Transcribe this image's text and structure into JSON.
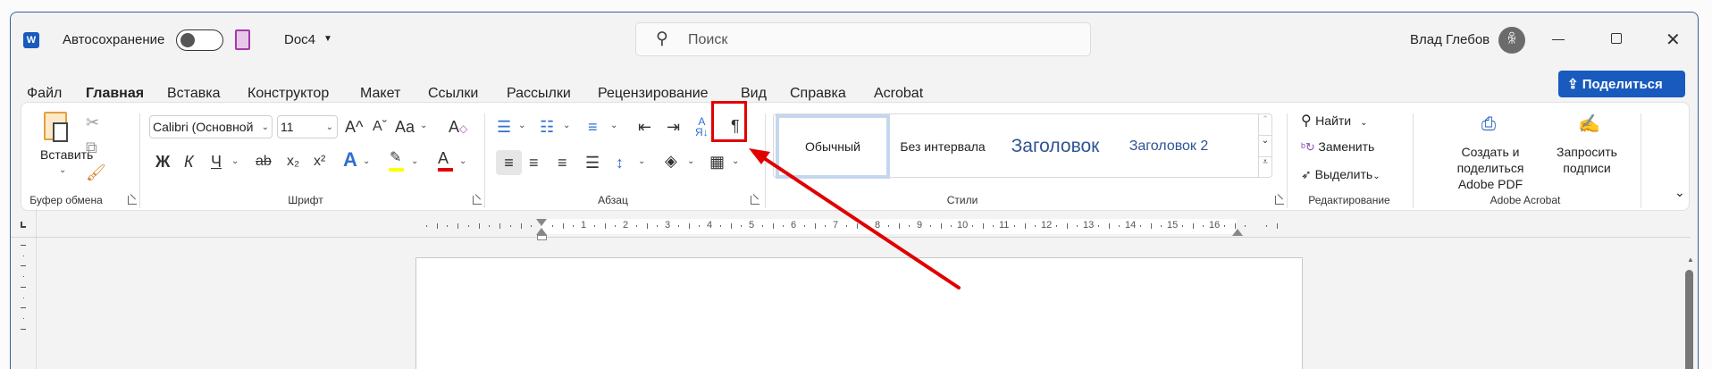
{
  "titlebar": {
    "app_icon": "word-icon",
    "autosave_label": "Автосохранение",
    "autosave_on": false,
    "doc_name": "Doc4",
    "search_placeholder": "Поиск",
    "user_name": "Влад Глебов"
  },
  "tabs": [
    "Файл",
    "Главная",
    "Вставка",
    "Конструктор",
    "Макет",
    "Ссылки",
    "Рассылки",
    "Рецензирование",
    "Вид",
    "Справка",
    "Acrobat"
  ],
  "active_tab": "Главная",
  "share_label": "Поделиться",
  "clipboard": {
    "paste": "Вставить",
    "group": "Буфер обмена"
  },
  "font": {
    "name": "Calibri (Основной",
    "size": "11",
    "grow": "A^",
    "shrink": "Aˇ",
    "case": "Aa",
    "bold": "Ж",
    "italic": "К",
    "underline": "Ч",
    "strike": "ab",
    "sub": "x₂",
    "sup": "x²",
    "group": "Шрифт"
  },
  "paragraph": {
    "pilcrow": "¶",
    "group": "Абзац"
  },
  "styles": {
    "items": [
      "Обычный",
      "Без интервала",
      "Заголовок",
      "Заголовок 2"
    ],
    "group": "Стили"
  },
  "editing": {
    "find": "Найти",
    "replace": "Заменить",
    "select": "Выделить",
    "group": "Редактирование"
  },
  "acrobat": {
    "create_l1": "Создать и поделиться",
    "create_l2": "Adobe PDF",
    "request_l1": "Запросить",
    "request_l2": "подписи",
    "group": "Adobe Acrobat"
  },
  "ruler": {
    "labels": [
      "1",
      "2",
      "3",
      "4",
      "5",
      "6",
      "7",
      "8",
      "9",
      "10",
      "11",
      "12",
      "13",
      "14",
      "15",
      "16"
    ]
  },
  "colors": {
    "accent": "#185abd",
    "highlight": "#ffff00",
    "font_color": "#e00000",
    "annotation": "#e00000"
  }
}
